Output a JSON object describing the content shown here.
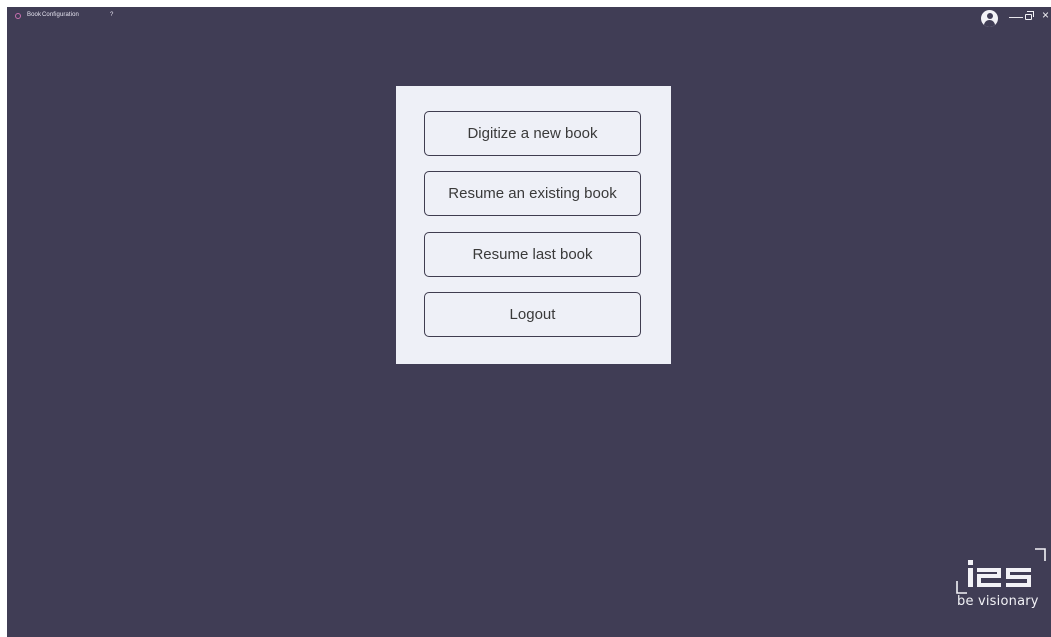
{
  "menu": {
    "book_label": "Book",
    "configuration_label": "Configuration",
    "help_label": "?"
  },
  "window_controls": {
    "minimize": "—",
    "close": "×"
  },
  "actions": {
    "digitize_label": "Digitize a new book",
    "resume_existing_label": "Resume an existing book",
    "resume_last_label": "Resume last book",
    "logout_label": "Logout"
  },
  "brand": {
    "logo_text": "i2S",
    "tagline": "be visionary"
  },
  "colors": {
    "background": "#403d55",
    "panel": "#eef0f7",
    "app_icon": "#c86fb0"
  }
}
